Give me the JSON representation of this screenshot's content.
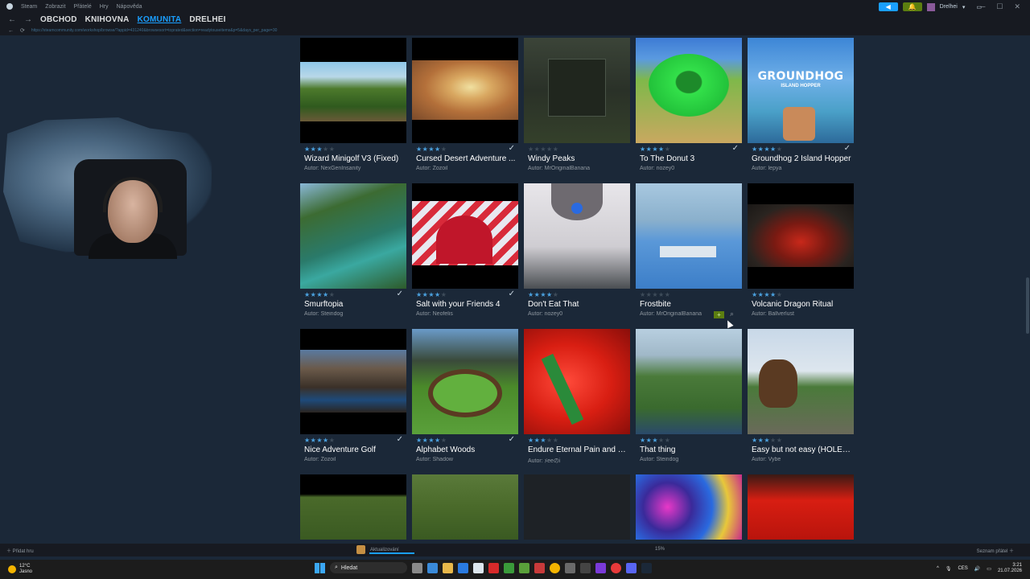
{
  "menubar": {
    "items": [
      "Steam",
      "Zobrazit",
      "Přátelé",
      "Hry",
      "Nápověda"
    ],
    "username": "Drelhei"
  },
  "nav": {
    "tabs": [
      {
        "label": "OBCHOD",
        "active": false
      },
      {
        "label": "KNIHOVNA",
        "active": false
      },
      {
        "label": "KOMUNITA",
        "active": true
      },
      {
        "label": "DRELHEI",
        "active": false
      }
    ],
    "active_color": "#1a9fff"
  },
  "url": "https://steamcommunity.com/workshop/browse/?appid=431240&browsesort=toprated&section=readytouseitems&p=5&days_per_page=30",
  "items": [
    {
      "title": "Wizard Minigolf V3 (Fixed)",
      "author": "Autor: NexGenInsanity",
      "rating": 3,
      "subscribed": false
    },
    {
      "title": "Cursed Desert Adventure ...",
      "author": "Autor: Zozoil",
      "rating": 4,
      "subscribed": true
    },
    {
      "title": "Windy Peaks",
      "author": "Autor: MrOriginalBanana",
      "rating": 0,
      "subscribed": false
    },
    {
      "title": "To The Donut 3",
      "author": "Autor: nozey0",
      "rating": 4,
      "subscribed": true
    },
    {
      "title": "Groundhog 2 Island Hopper",
      "author": "Autor: lepya",
      "rating": 4,
      "subscribed": true
    },
    {
      "title": "Smurftopia",
      "author": "Autor: Steindog",
      "rating": 4,
      "subscribed": true
    },
    {
      "title": "Salt with your Friends 4",
      "author": "Autor: Neofelis",
      "rating": 4,
      "subscribed": true
    },
    {
      "title": "Don't Eat That",
      "author": "Autor: nozey0",
      "rating": 4,
      "subscribed": false
    },
    {
      "title": "Frostbite",
      "author": "Autor: MrOriginalBanana",
      "rating": 0,
      "subscribed": false
    },
    {
      "title": "Volcanic Dragon Ritual",
      "author": "Autor: Ballverlust",
      "rating": 4,
      "subscribed": false
    },
    {
      "title": "Nice Adventure Golf",
      "author": "Autor: Zozoil",
      "rating": 4,
      "subscribed": true
    },
    {
      "title": "Alphabet Woods",
      "author": "Autor: Shadow",
      "rating": 4,
      "subscribed": true
    },
    {
      "title": "Endure Eternal Pain and S...",
      "author": "Autor: ﾒeeのi",
      "rating": 3,
      "subscribed": false
    },
    {
      "title": "That thing",
      "author": "Autor: Steindog",
      "rating": 3,
      "subscribed": false
    },
    {
      "title": "Easy but not easy (HOLE-I...",
      "author": "Autor: Vybe",
      "rating": 3,
      "subscribed": false
    }
  ],
  "groundhog_logo": {
    "title": "GROUNDHOG",
    "subtitle": "ISLAND HOPPER"
  },
  "hover_add_label": "+",
  "statusbar": {
    "add_game": "Přidat hru",
    "download_label": "Aktualizování",
    "download_progress": 0.15,
    "download_percent": "15%",
    "friends_chat": "Seznam přátel"
  },
  "taskbar": {
    "temperature": "12°C",
    "weather": "Jasno",
    "search_label": "Hledat",
    "language": "CES",
    "time": "3:21",
    "date": "21.07.2026"
  }
}
